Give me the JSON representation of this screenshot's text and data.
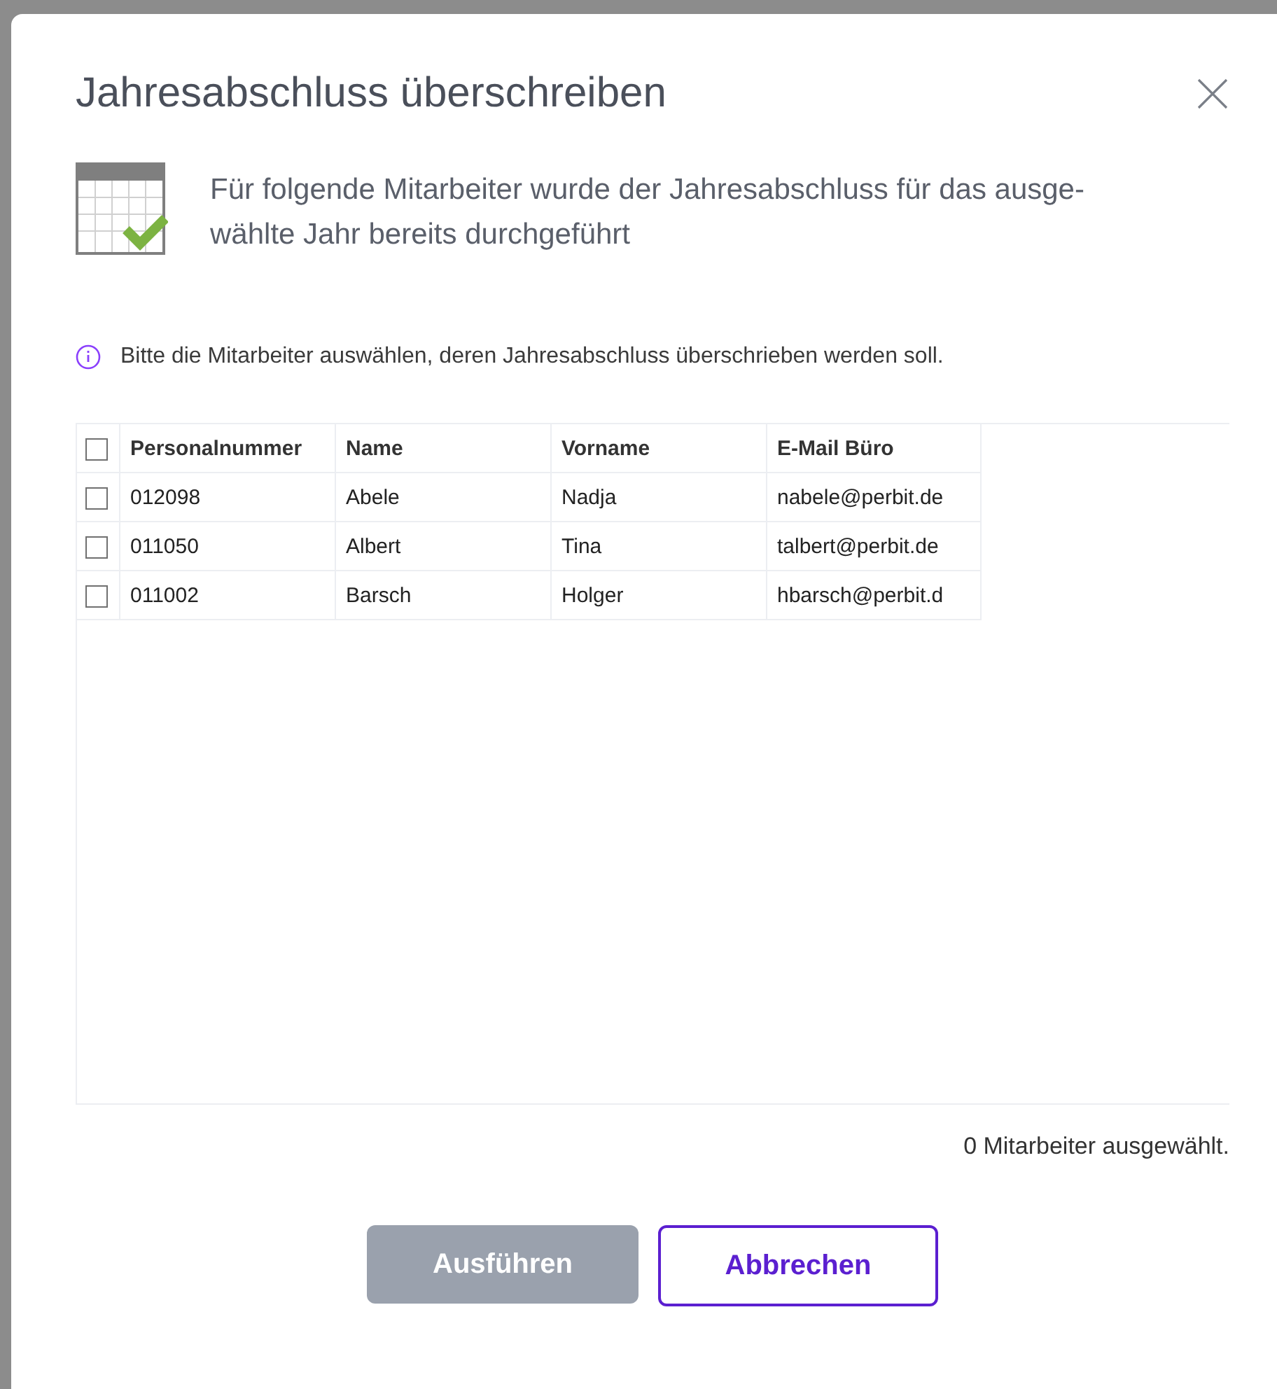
{
  "dialog": {
    "title": "Jahresabschluss überschreiben",
    "message": "Für folgende Mitarbeiter wurde der Jahresabschluss für das ausge-wählte Jahr bereits durchgeführt",
    "hint": "Bitte die Mitarbeiter auswählen, deren Jahresabschluss überschrieben werden soll."
  },
  "table": {
    "select_all": {
      "checked": false
    },
    "columns": [
      "Personalnummer",
      "Name",
      "Vorname",
      "E-Mail Büro"
    ],
    "rows": [
      {
        "checked": false,
        "cells": [
          "012098",
          "Abele",
          "Nadja",
          "nabele@perbit.de"
        ]
      },
      {
        "checked": false,
        "cells": [
          "011050",
          "Albert",
          "Tina",
          "talbert@perbit.de"
        ]
      },
      {
        "checked": false,
        "cells": [
          "011002",
          "Barsch",
          "Holger",
          "hbarsch@perbit.d"
        ]
      }
    ]
  },
  "selection_count": "0 Mitarbeiter ausgewählt.",
  "buttons": [
    {
      "label": "Ausführen",
      "kind": "primary",
      "disabled": true
    },
    {
      "label": "Abbrechen",
      "kind": "secondary",
      "disabled": false
    }
  ]
}
